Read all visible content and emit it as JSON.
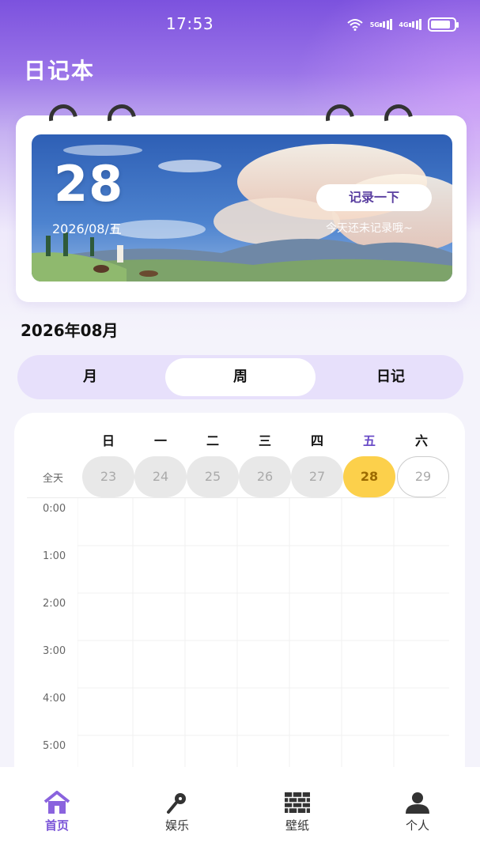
{
  "status_bar": {
    "time": "17:53",
    "network_1": "5G",
    "network_2": "4G",
    "battery_level": 0.85
  },
  "app": {
    "title": "日记本"
  },
  "calendar_card": {
    "day": "28",
    "date_line": "2026/08/五",
    "record_button": "记录一下",
    "hint": "今天还未记录哦~"
  },
  "month_title": "2026年08月",
  "view_tabs": {
    "month": "月",
    "week": "周",
    "diary": "日记",
    "selected": "周"
  },
  "week_view": {
    "allday_label": "全天",
    "weekdays": [
      "日",
      "一",
      "二",
      "三",
      "四",
      "五",
      "六"
    ],
    "dates": [
      "23",
      "24",
      "25",
      "26",
      "27",
      "28",
      "29"
    ],
    "today_index": 5,
    "hours": [
      "0:00",
      "1:00",
      "2:00",
      "3:00",
      "4:00",
      "5:00"
    ]
  },
  "tab_bar": {
    "items": [
      {
        "label": "首页",
        "icon": "home-icon",
        "active": true
      },
      {
        "label": "娱乐",
        "icon": "microphone-icon",
        "active": false
      },
      {
        "label": "壁纸",
        "icon": "brick-wall-icon",
        "active": false
      },
      {
        "label": "个人",
        "icon": "person-icon",
        "active": false
      }
    ]
  },
  "colors": {
    "accent": "#7a55d8",
    "today": "#fcd04b",
    "segment_bg": "#e7e0fb"
  }
}
